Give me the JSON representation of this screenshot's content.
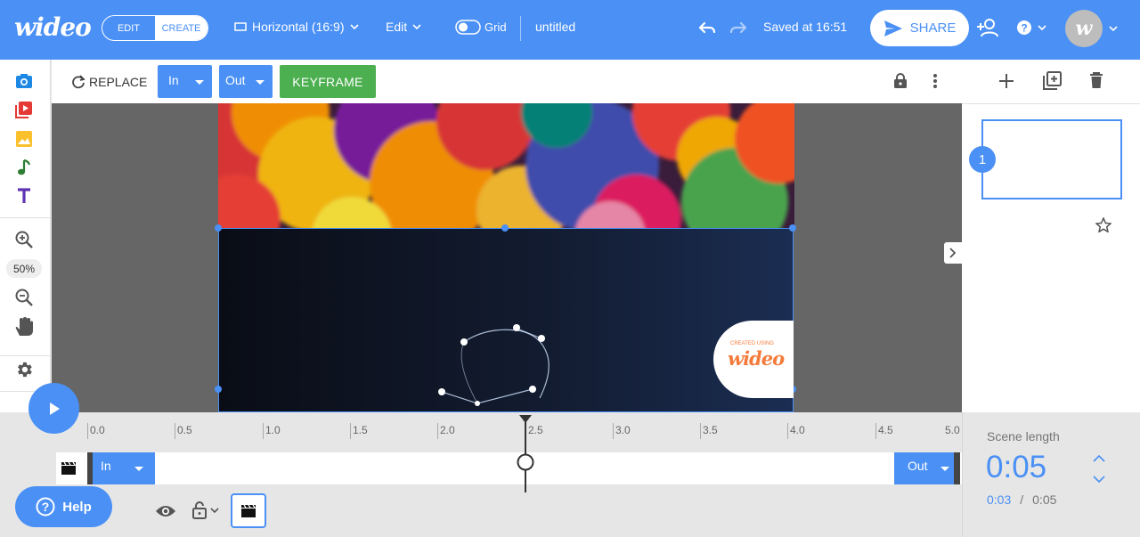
{
  "app": {
    "logo": "wideo"
  },
  "header": {
    "mode_edit": "EDIT",
    "mode_create": "CREATE",
    "format": "Horizontal (16:9)",
    "edit_menu": "Edit",
    "grid_label": "Grid",
    "title": "untitled",
    "saved_status": "Saved at 16:51",
    "share_label": "SHARE",
    "avatar_initial": "w"
  },
  "toolbar": {
    "replace_label": "REPLACE",
    "in_label": "In",
    "out_label": "Out",
    "keyframe_label": "KEYFRAME"
  },
  "leftrail": {
    "zoom_level": "50%",
    "tools": [
      "camera-icon",
      "video-icon",
      "image-icon",
      "music-icon",
      "text-icon",
      "zoom-in-icon",
      "zoom-out-icon",
      "hand-icon",
      "settings-icon"
    ]
  },
  "canvas": {
    "badge_small": "CREATED USING",
    "badge_logo": "wideo"
  },
  "scenes": {
    "items": [
      {
        "number": "1"
      }
    ]
  },
  "timeline": {
    "ticks": [
      "0.0",
      "0.5",
      "1.0",
      "1.5",
      "2.0",
      "2.5",
      "3.0",
      "3.5",
      "4.0",
      "4.5",
      "5.0"
    ],
    "in_label": "In",
    "out_label": "Out",
    "playhead_time": 2.5
  },
  "scene_length": {
    "label": "Scene length",
    "value": "0:05",
    "current": "0:03",
    "separator": "/",
    "total": "0:05"
  },
  "help": {
    "label": "Help"
  },
  "colors": {
    "accent": "#4a90f5",
    "keyframe": "#4caf50",
    "badge_text": "#f47b3c"
  }
}
